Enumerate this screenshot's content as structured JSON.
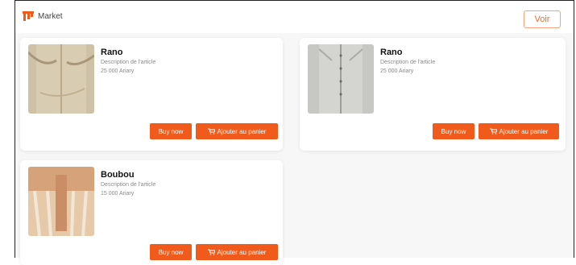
{
  "header": {
    "brand": "Market",
    "action_label": "Voir"
  },
  "products": [
    {
      "name": "Rano",
      "description": "Description de l'article",
      "price": "25 000 Ariary",
      "buy_label": "Buy now",
      "cart_label": "Ajouter au panier"
    },
    {
      "name": "Rano",
      "description": "Description de l'article",
      "price": "25 000 Ariary",
      "buy_label": "Buy now",
      "cart_label": "Ajouter au panier"
    },
    {
      "name": "Boubou",
      "description": "Description de l'article",
      "price": "15 000 Ariary",
      "buy_label": "Buy now",
      "cart_label": "Ajouter au panier"
    }
  ],
  "colors": {
    "accent": "#f05a1a",
    "background": "#f7f7f7"
  }
}
